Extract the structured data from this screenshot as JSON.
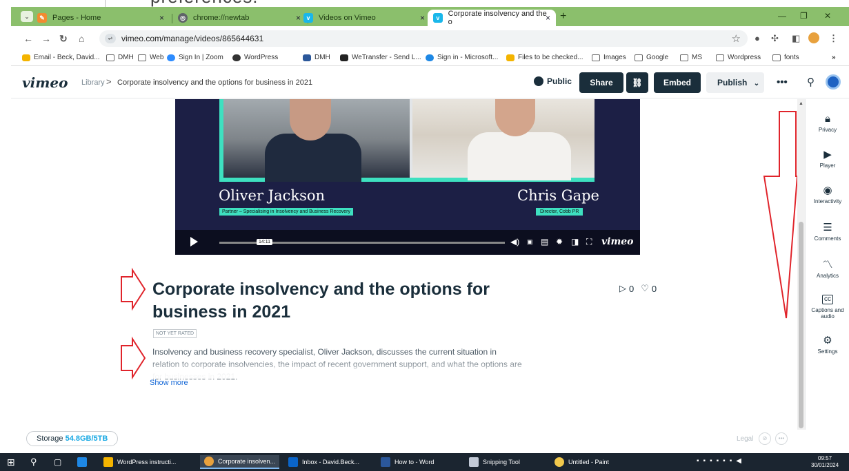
{
  "overlay_fragment": "preferences.",
  "browser": {
    "tabs": [
      {
        "label": "Pages - Home",
        "icon": "pages-icon",
        "color": "#f28b30"
      },
      {
        "label": "chrome://newtab",
        "icon": "chrome-icon",
        "color": "#5f6368"
      },
      {
        "label": "Videos on Vimeo",
        "icon": "vimeo-icon",
        "color": "#1ab7ea"
      },
      {
        "label": "Corporate insolvency and the o",
        "icon": "vimeo-icon",
        "color": "#1ab7ea",
        "active": true
      }
    ],
    "url": "vimeo.com/manage/videos/865644631",
    "bookmarks": [
      "Email - Beck, David...",
      "DMH",
      "Web",
      "Sign In | Zoom",
      "WordPress",
      "DMH",
      "WeTransfer - Send L...",
      "Sign in - Microsoft...",
      "Files to be checked...",
      "Images",
      "Google",
      "MS",
      "Wordpress",
      "fonts"
    ],
    "bookmarks_more": "»"
  },
  "vimeo": {
    "logo": "vimeo",
    "breadcrumb": {
      "library": "Library",
      "separator": ">",
      "current": "Corporate insolvency and the options for business in 2021"
    },
    "privacy_label": "Public",
    "share_label": "Share",
    "link_label": "⛓",
    "embed_label": "Embed",
    "publish_label": "Publish",
    "more_label": "•••"
  },
  "video": {
    "left_name": "Oliver Jackson",
    "left_role": "Partner – Specialising in Insolvency and Business Recovery",
    "right_name": "Chris Gape",
    "right_role": "Director, Cobb PR",
    "timestamp": "14:11",
    "brand": "vimeo"
  },
  "details": {
    "title": "Corporate insolvency and the options for business in 2021",
    "plays": "0",
    "likes": "0",
    "rating": "NOT YET RATED",
    "description": "Insolvency and business recovery specialist, Oliver Jackson, discusses the current situation in relation to corporate insolvencies, the impact of recent government support, and what the options are for businesses in 2021.",
    "show_more": "Show more"
  },
  "rail": [
    {
      "label": "Privacy",
      "icon": "lock-icon"
    },
    {
      "label": "Player",
      "icon": "player-icon"
    },
    {
      "label": "Interactivity",
      "icon": "interactivity-icon"
    },
    {
      "label": "Comments",
      "icon": "comments-icon"
    },
    {
      "label": "Analytics",
      "icon": "analytics-icon"
    },
    {
      "label": "Captions and audio",
      "icon": "captions-icon"
    },
    {
      "label": "Settings",
      "icon": "settings-icon"
    }
  ],
  "footer": {
    "storage_label": "Storage",
    "storage_value": "54.8GB/5TB",
    "legal": "Legal"
  },
  "taskbar": {
    "items": [
      "WordPress instructi...",
      "Corporate insolven...",
      "Inbox - David.Beck...",
      "How to - Word",
      "Snipping Tool",
      "Untitled - Paint"
    ],
    "time": "09:57",
    "date": "30/01/2024"
  },
  "colors": {
    "tabbar": "#8bbf6c",
    "vimeo_dark": "#1a2e3b",
    "accent_teal": "#3ee0c0",
    "arrow_red": "#e0242b",
    "storage_blue": "#17a8e3"
  }
}
